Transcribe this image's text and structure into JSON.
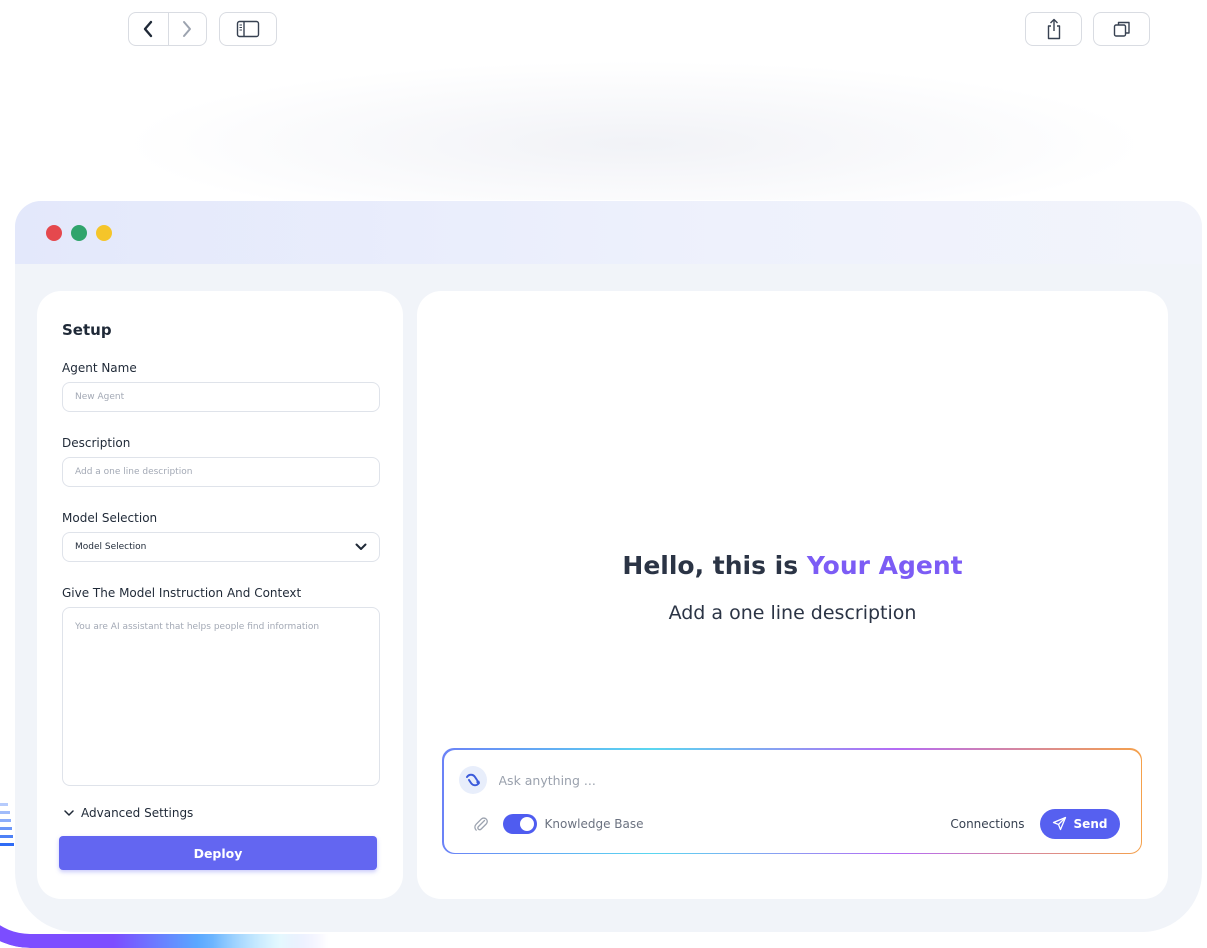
{
  "browser": {
    "back_icon": "chevron-left-icon",
    "forward_icon": "chevron-right-icon",
    "sidebar_icon": "sidebar-icon",
    "share_icon": "share-icon",
    "tabs_icon": "tabs-icon"
  },
  "window": {
    "traffic_lights": [
      "#e5484d",
      "#30a46c",
      "#f5c52a"
    ]
  },
  "setup": {
    "title": "Setup",
    "agent_name": {
      "label": "Agent Name",
      "placeholder": "New Agent",
      "value": ""
    },
    "description": {
      "label": "Description",
      "placeholder": "Add a one line description",
      "value": ""
    },
    "model_selection": {
      "label": "Model Selection",
      "selected": "Model Selection",
      "icon": "chevron-down-icon"
    },
    "instructions": {
      "label": "Give The Model Instruction And Context",
      "placeholder": "You are AI assistant that helps people find information",
      "value": ""
    },
    "advanced_settings": "Advanced Settings",
    "deploy_label": "Deploy"
  },
  "chat": {
    "greeting_prefix": "Hello, this is ",
    "greeting_highlight": "Your Agent",
    "subline": "Add a one line description",
    "composer": {
      "placeholder": "Ask anything ...",
      "value": "",
      "knowledge_base_label": "Knowledge Base",
      "knowledge_base_on": true,
      "connections_label": "Connections",
      "send_label": "Send"
    }
  },
  "colors": {
    "accent": "#6366f1",
    "highlight": "#7c5cf5",
    "window_bg": "#f1f4f9"
  }
}
